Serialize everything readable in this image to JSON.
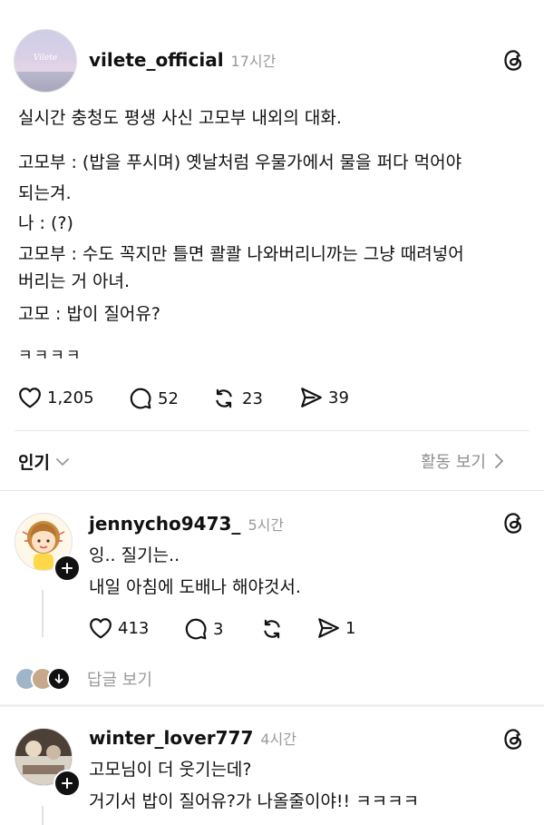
{
  "post": {
    "username": "vilete_official",
    "time": "17시간",
    "avatar_text": "Vilete",
    "lines": [
      "실시간 충청도 평생 사신 고모부 내외의 대화.",
      "고모부 : (밥을 푸시며) 옛날처럼 우물가에서 물을 퍼다 먹어야",
      "되는겨.",
      "나 : (?)",
      "고모부 : 수도 꼭지만 틀면 콸콸 나와버리니까는 그냥 때려넣어",
      "버리는 거 아녀.",
      "고모 : 밥이 질어유?",
      "ㅋㅋㅋㅋ"
    ],
    "likes": "1,205",
    "comments": "52",
    "reposts": "23",
    "shares": "39"
  },
  "sort": {
    "label": "인기",
    "activity_label": "활동 보기"
  },
  "replies": [
    {
      "username": "jennycho9473_",
      "time": "5시간",
      "lines": [
        "잉.. 질기는..",
        "내일 아침에 도배나 해야것서."
      ],
      "likes": "413",
      "comments": "3",
      "shares": "1",
      "view_replies_label": "답글 보기"
    },
    {
      "username": "winter_lover777",
      "time": "4시간",
      "lines": [
        "고모님이 더 웃기는데?",
        "거기서 밥이 질어유?가 나올줄이야!! ㅋㅋㅋㅋ"
      ]
    }
  ],
  "colors": {
    "text": "#111111",
    "muted": "#9a9a9a",
    "divider": "#e6e6e6"
  },
  "icons": [
    "threads-icon",
    "heart-icon",
    "comment-icon",
    "repost-icon",
    "share-icon",
    "chevron-down-icon",
    "chevron-right-icon",
    "plus-icon",
    "arrow-down-icon"
  ]
}
